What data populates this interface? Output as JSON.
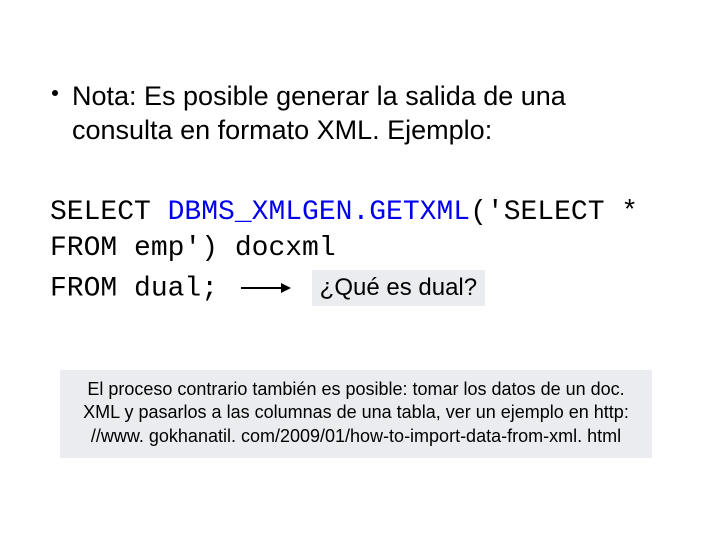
{
  "bullet": {
    "text": "Nota: Es posible generar la salida de una consulta en formato XML. Ejemplo:"
  },
  "code": {
    "kw_select": "SELECT ",
    "fn": "DBMS_XMLGEN.GETXML",
    "arg_open": "('",
    "inner": "SELECT * FROM emp",
    "arg_close": "') ",
    "alias": "docxml",
    "from": "FROM dual",
    "semi": ";"
  },
  "callout": {
    "text": "¿Qué es dual?"
  },
  "footnote": {
    "text": "El proceso contrario también es posible: tomar los datos de un doc. XML y pasarlos a las columnas de una tabla, ver un ejemplo en http: //www. gokhanatil. com/2009/01/how-to-import-data-from-xml. html"
  }
}
